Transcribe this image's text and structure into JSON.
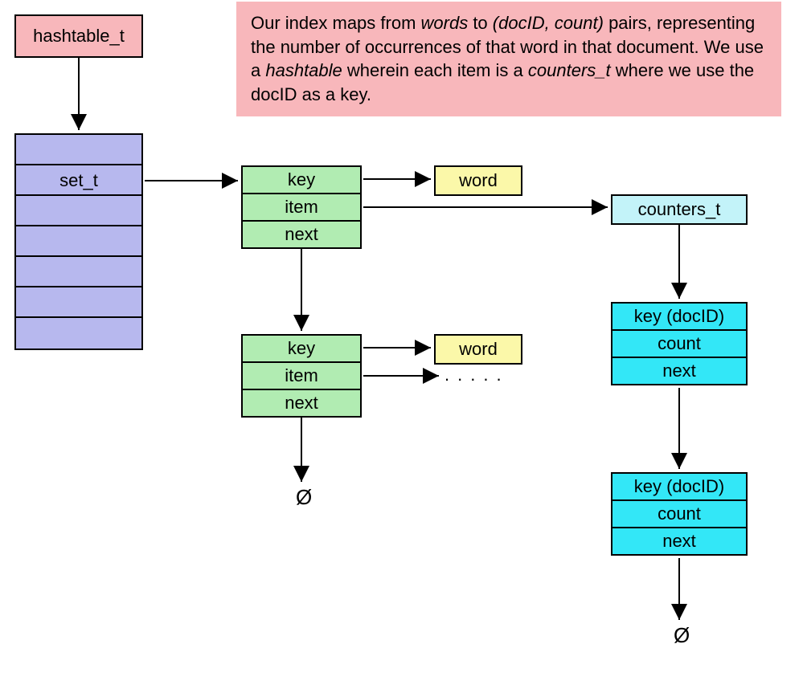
{
  "hashtable": {
    "label": "hashtable_t"
  },
  "description": {
    "p1": "Our index maps from ",
    "i1": "words",
    "p2": " to ",
    "i2": "(docID, count)",
    "p3": " pairs, representing the number of occurrences of that word in that document. We use a ",
    "i3": "hashtable",
    "p4": " wherein each item is a ",
    "i4": "counters_t",
    "p5": " where we use the docID as a key."
  },
  "array": {
    "set_label": "set_t"
  },
  "setnode": {
    "key": "key",
    "item": "item",
    "next": "next"
  },
  "word": {
    "label": "word"
  },
  "counters": {
    "label": "counters_t"
  },
  "counternode": {
    "key": "key (docID)",
    "count": "count",
    "next": "next"
  },
  "null": {
    "symbol": "Ø"
  },
  "dots": {
    "text": "....."
  }
}
